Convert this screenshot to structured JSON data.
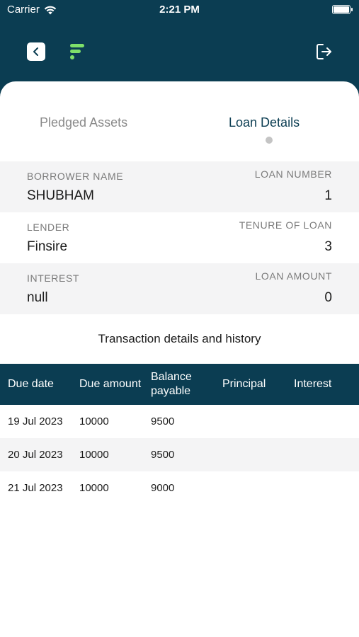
{
  "status_bar": {
    "carrier": "Carrier",
    "time": "2:21 PM"
  },
  "header": {
    "back_icon": "chevron-left-icon",
    "logo_icon": "app-logo",
    "logout_icon": "logout-icon"
  },
  "tabs": [
    {
      "label": "Pledged Assets",
      "active": false
    },
    {
      "label": "Loan Details",
      "active": true
    }
  ],
  "details": {
    "borrower_name_label": "BORROWER NAME",
    "borrower_name": "SHUBHAM",
    "loan_number_label": "LOAN NUMBER",
    "loan_number": "1",
    "lender_label": "LENDER",
    "lender": "Finsire",
    "tenure_label": "TENURE OF LOAN",
    "tenure": "3",
    "interest_label": "INTEREST",
    "interest": "null",
    "loan_amount_label": "LOAN AMOUNT",
    "loan_amount": "0"
  },
  "transactions": {
    "title": "Transaction details and history",
    "columns": [
      "Due date",
      "Due amount",
      "Balance payable",
      "Principal",
      "Interest"
    ],
    "rows": [
      [
        "19 Jul 2023",
        "10000",
        "9500",
        "",
        ""
      ],
      [
        "20 Jul 2023",
        "10000",
        "9500",
        "",
        ""
      ],
      [
        "21 Jul 2023",
        "10000",
        "9000",
        "",
        ""
      ]
    ]
  },
  "colors": {
    "primary": "#0b3d52",
    "accent": "#7ee06a",
    "row_shade": "#f4f4f5",
    "muted": "#8a8a8a"
  }
}
